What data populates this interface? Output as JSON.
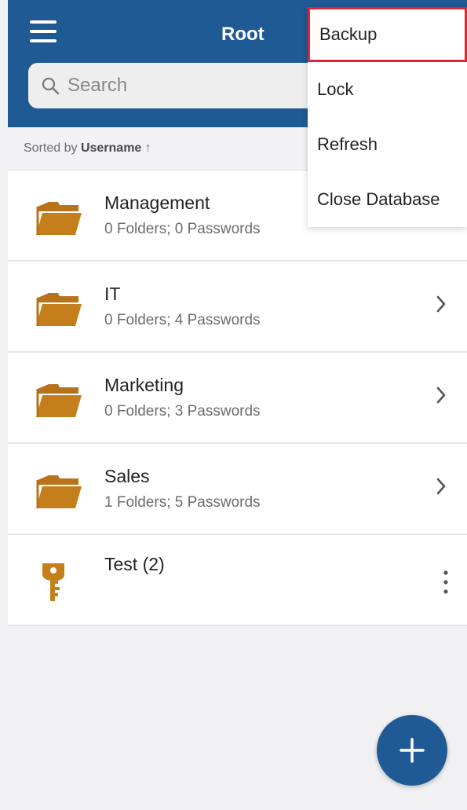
{
  "header": {
    "title": "Root",
    "search_placeholder": "Search",
    "color": "#1f5a94"
  },
  "sort": {
    "prefix": "Sorted by",
    "field": "Username",
    "arrow": "↑"
  },
  "items": [
    {
      "name": "Management",
      "sub": "0 Folders; 0 Passwords",
      "type": "folder",
      "icon": "folder-icon"
    },
    {
      "name": "IT",
      "sub": "0 Folders; 4 Passwords",
      "type": "folder",
      "icon": "folder-icon"
    },
    {
      "name": "Marketing",
      "sub": "0 Folders; 3 Passwords",
      "type": "folder",
      "icon": "folder-icon"
    },
    {
      "name": "Sales",
      "sub": "1 Folders; 5 Passwords",
      "type": "folder",
      "icon": "folder-icon"
    },
    {
      "name": "Test (2)",
      "type": "entry",
      "icon": "key-icon"
    }
  ],
  "menu": {
    "items": [
      "Backup",
      "Lock",
      "Refresh",
      "Close Database"
    ],
    "highlight_color": "#e02434"
  },
  "fab": {
    "icon": "plus-icon"
  },
  "colors": {
    "folder": "#c47f1c",
    "accent": "#1f5a94"
  }
}
